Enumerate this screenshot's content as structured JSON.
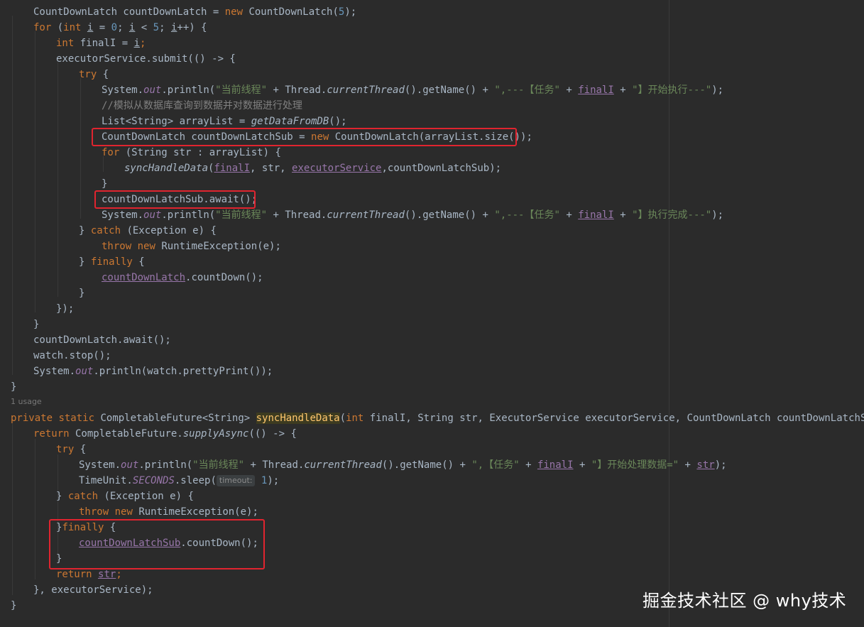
{
  "editor": {
    "lines": [
      [
        "CountDownLatch countDownLatch = ",
        "new",
        " CountDownLatch(",
        "5",
        ");"
      ],
      [
        "for",
        " (",
        "int",
        " ",
        "i",
        " = ",
        "0",
        "; ",
        "i",
        " < ",
        "5",
        "; ",
        "i",
        "++) {"
      ],
      [
        "int",
        " finalI = ",
        "i",
        ";"
      ],
      [
        "executorService.submit(() -> {"
      ],
      [
        "try",
        " {"
      ],
      [
        "System.",
        "out",
        ".println(",
        "\"当前线程\"",
        " + Thread.",
        "currentThread",
        "().getName() + ",
        "\",---【任务\"",
        " + ",
        "finalI",
        " + ",
        "\"】开始执行---\"",
        ");"
      ],
      [
        "//模拟从数据库查询到数据并对数据进行处理"
      ],
      [
        "List<String> arrayList = ",
        "getDataFromDB",
        "();"
      ],
      [
        "CountDownLatch countDownLatchSub = ",
        "new",
        " CountDownLatch(arrayList.size());"
      ],
      [
        "for",
        " (String str : arrayList) {"
      ],
      [
        "syncHandleData",
        "(",
        "finalI",
        ", str, ",
        "executorService",
        ",countDownLatchSub);"
      ],
      [
        "}"
      ],
      [
        "countDownLatchSub.await();"
      ],
      [
        "System.",
        "out",
        ".println(",
        "\"当前线程\"",
        " + Thread.",
        "currentThread",
        "().getName() + ",
        "\",---【任务\"",
        " + ",
        "finalI",
        " + ",
        "\"】执行完成---\"",
        ");"
      ],
      [
        "} ",
        "catch",
        " (Exception e) {"
      ],
      [
        "throw",
        " ",
        "new",
        " RuntimeException(e);"
      ],
      [
        "} ",
        "finally",
        " {"
      ],
      [
        "countDownLatch",
        ".countDown();"
      ],
      [
        "}"
      ],
      [
        "});"
      ],
      [
        "}"
      ],
      [
        "countDownLatch.await();"
      ],
      [
        "watch.stop();"
      ],
      [
        "System.",
        "out",
        ".println(watch.prettyPrint());"
      ],
      [
        "}"
      ],
      [
        "private",
        " ",
        "static",
        " CompletableFuture<String> ",
        "syncHandleData",
        "(",
        "int",
        " finalI, String str, ExecutorService executorService, CountDownLatch countDownLatchSub) {"
      ],
      [
        "return",
        " CompletableFuture.",
        "supplyAsync",
        "(() -> {"
      ],
      [
        "try",
        " {"
      ],
      [
        "System.",
        "out",
        ".println(",
        "\"当前线程\"",
        " + Thread.",
        "currentThread",
        "().getName() + ",
        "\",【任务\"",
        " + ",
        "finalI",
        " + ",
        "\"】开始处理数据=\"",
        " + ",
        "str",
        ");"
      ],
      [
        "TimeUnit.",
        "SECONDS",
        ".sleep(",
        "timeout:",
        " ",
        "1",
        ");"
      ],
      [
        "} ",
        "catch",
        " (Exception e) {"
      ],
      [
        "throw",
        " ",
        "new",
        " RuntimeException(e);"
      ],
      [
        "}",
        "finally",
        " {"
      ],
      [
        "countDownLatchSub",
        ".countDown();"
      ],
      [
        "}"
      ],
      [
        "return",
        " ",
        "str",
        ";"
      ],
      [
        "}, executorService);"
      ],
      [
        "}"
      ]
    ],
    "usage_hint": "1 usage"
  },
  "watermark": "掘金技术社区 @ why技术"
}
